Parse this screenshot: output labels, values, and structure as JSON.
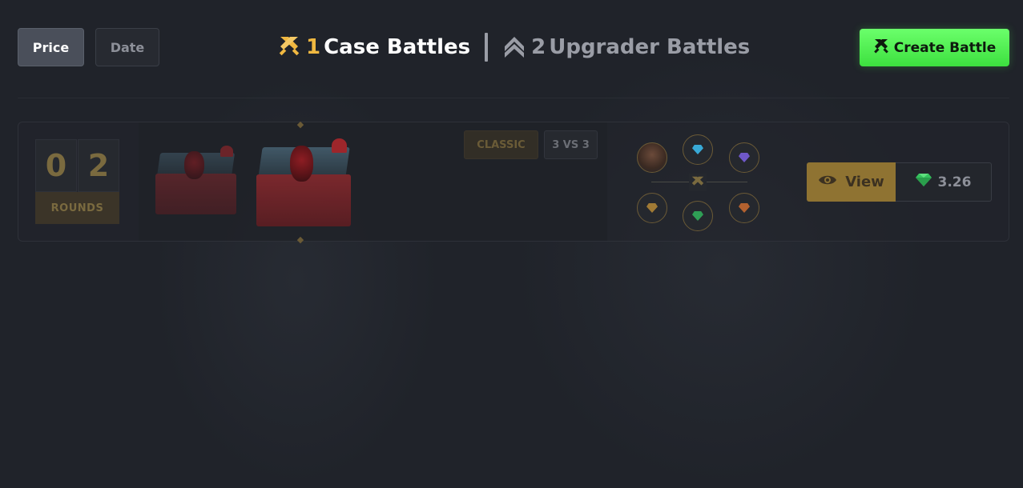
{
  "sort": {
    "price_label": "Price",
    "date_label": "Date"
  },
  "modes": {
    "case": {
      "count": "1",
      "label": "Case Battles"
    },
    "upgrader": {
      "count": "2",
      "label": "Upgrader Battles"
    }
  },
  "create_button": {
    "label": "Create Battle"
  },
  "battles": [
    {
      "rounds_digits": [
        "0",
        "2"
      ],
      "rounds_label": "ROUNDS",
      "mode_tag": "CLASSIC",
      "teams_tag": "3 VS 3",
      "view_label": "View",
      "price": "3.26"
    }
  ],
  "colors": {
    "accent_gold": "#f0b841",
    "create_green": "#4df04f",
    "gem_green": "#35c25e"
  }
}
